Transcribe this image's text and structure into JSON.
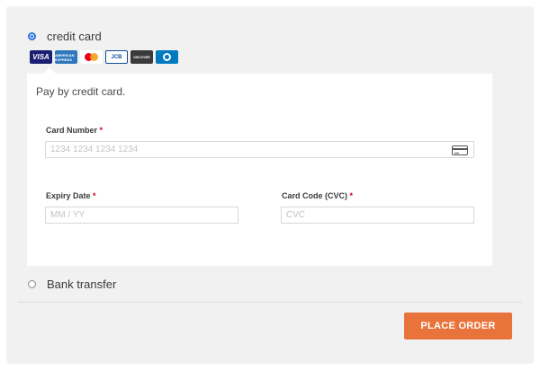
{
  "payment_methods": {
    "credit_card": {
      "label": "credit card",
      "selected": true
    },
    "bank_transfer": {
      "label": "Bank transfer",
      "selected": false
    }
  },
  "card_brands": [
    {
      "name": "visa-icon",
      "text": "VISA",
      "color": "#1a1f71"
    },
    {
      "name": "amex-icon",
      "text": "AMERICAN EXPRESS",
      "color": "#2e77bc"
    },
    {
      "name": "mastercard-icon",
      "text": "",
      "color": "#eb001b"
    },
    {
      "name": "jcb-icon",
      "text": "JCB",
      "color": "#0e4c96"
    },
    {
      "name": "discover-icon",
      "text": "DISCOVER",
      "color": "#3a3a3a"
    },
    {
      "name": "diners-icon",
      "text": "",
      "color": "#0079be"
    }
  ],
  "credit_card_form": {
    "description": "Pay by credit card.",
    "card_number": {
      "label": "Card Number",
      "required_mark": "*",
      "placeholder": "1234 1234 1234 1234",
      "value": ""
    },
    "expiry_date": {
      "label": "Expiry Date",
      "required_mark": "*",
      "placeholder": "MM / YY",
      "value": ""
    },
    "card_code": {
      "label": "Card Code (CVC)",
      "required_mark": "*",
      "placeholder": "CVC",
      "value": ""
    }
  },
  "actions": {
    "place_order_label": "PLACE ORDER"
  },
  "colors": {
    "accent_button": "#e8743b",
    "radio_selected": "#2f6fde",
    "required": "#d0021b",
    "panel_background": "#f1f1f1"
  }
}
